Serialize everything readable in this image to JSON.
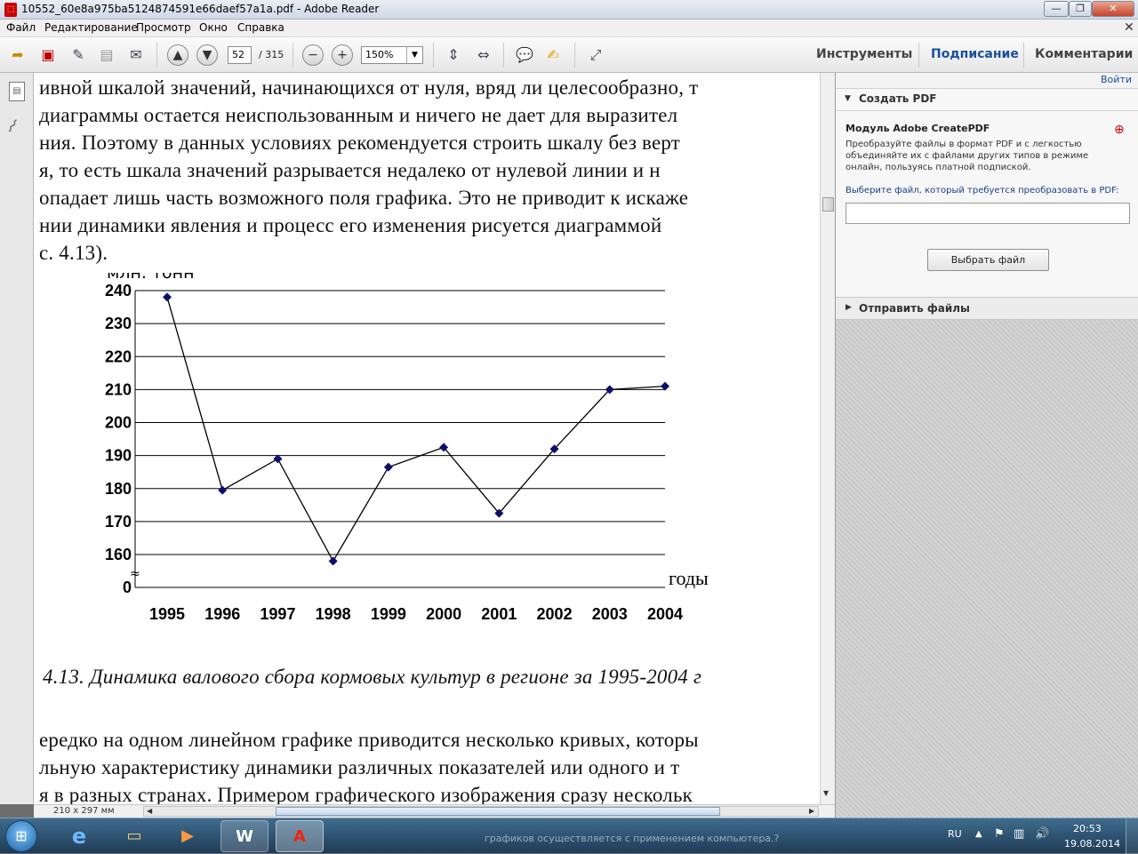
{
  "window": {
    "title": "10552_60e8a975ba5124874591e66daef57a1a.pdf - Adobe Reader"
  },
  "menu": [
    "Файл",
    "Редактирование",
    "Просмотр",
    "Окно",
    "Справка"
  ],
  "toolbar": {
    "page_current": "52",
    "page_total": "/ 315",
    "zoom": "150%",
    "tools_label": "Инструменты",
    "sign_label": "Подписание",
    "comments_label": "Комментарии"
  },
  "document": {
    "lines": [
      "ивной шкалой значений, начинающихся от нуля, вряд ли целесообразно, т",
      "диаграммы остается неиспользованным и ничего не дает для выразител",
      "ния. Поэтому в данных условиях рекомендуется строить шкалу без верт",
      "я, то есть шкала значений разрывается недалеко от нулевой линии и н",
      "опадает лишь часть возможного поля графика. Это не приводит к искаже",
      "нии динамики явления и процесс его изменения рисуется диаграммой",
      "с. 4.13)."
    ],
    "caption": "4.13. Динамика валового сбора кормовых культур в регионе за 1995-2004 г",
    "lines_after": [
      "ередко на одном линейном графике приводится несколько кривых, которы",
      "льную характеристику динамики различных показателей или одного и т",
      "я в разных странах. Примером графического изображения сразу нескольк"
    ]
  },
  "chart_data": {
    "type": "line",
    "title": "",
    "ylabel": "млн. тонн",
    "xlabel": "годы",
    "categories": [
      "1995",
      "1996",
      "1997",
      "1998",
      "1999",
      "2000",
      "2001",
      "2002",
      "2003",
      "2004"
    ],
    "values": [
      238,
      179.5,
      189,
      158,
      186.5,
      192.5,
      172.5,
      192,
      210,
      211
    ],
    "yticks": [
      "240",
      "230",
      "220",
      "210",
      "200",
      "190",
      "180",
      "170",
      "160",
      "0"
    ],
    "ylim": [
      160,
      240
    ],
    "axis_break": true,
    "grid": "horizontal",
    "line_color": "#000000",
    "marker_color": "#0b0f6b"
  },
  "status": {
    "page_size": "210 x 297 мм"
  },
  "right_panel": {
    "signin": "Войти",
    "create_pdf_header": "Создать PDF",
    "module_title": "Модуль Adobe CreatePDF",
    "module_desc_1": "Преобразуйте файлы в формат PDF и с легкостью",
    "module_desc_2": "объединяйте их с файлами других типов в режиме",
    "module_desc_3": "онлайн, пользуясь платной подпиской.",
    "select_label": "Выберите файл, который требуется преобразовать в PDF:",
    "select_button": "Выбрать файл",
    "send_header": "Отправить файлы"
  },
  "taskbar": {
    "lang": "RU",
    "time": "20:53",
    "date": "19.08.2014",
    "bg_text": "графиков осуществляется с применением компьютера.?"
  },
  "colors": {
    "accent_link": "#1a4f9c",
    "panel_header": "#333333"
  }
}
